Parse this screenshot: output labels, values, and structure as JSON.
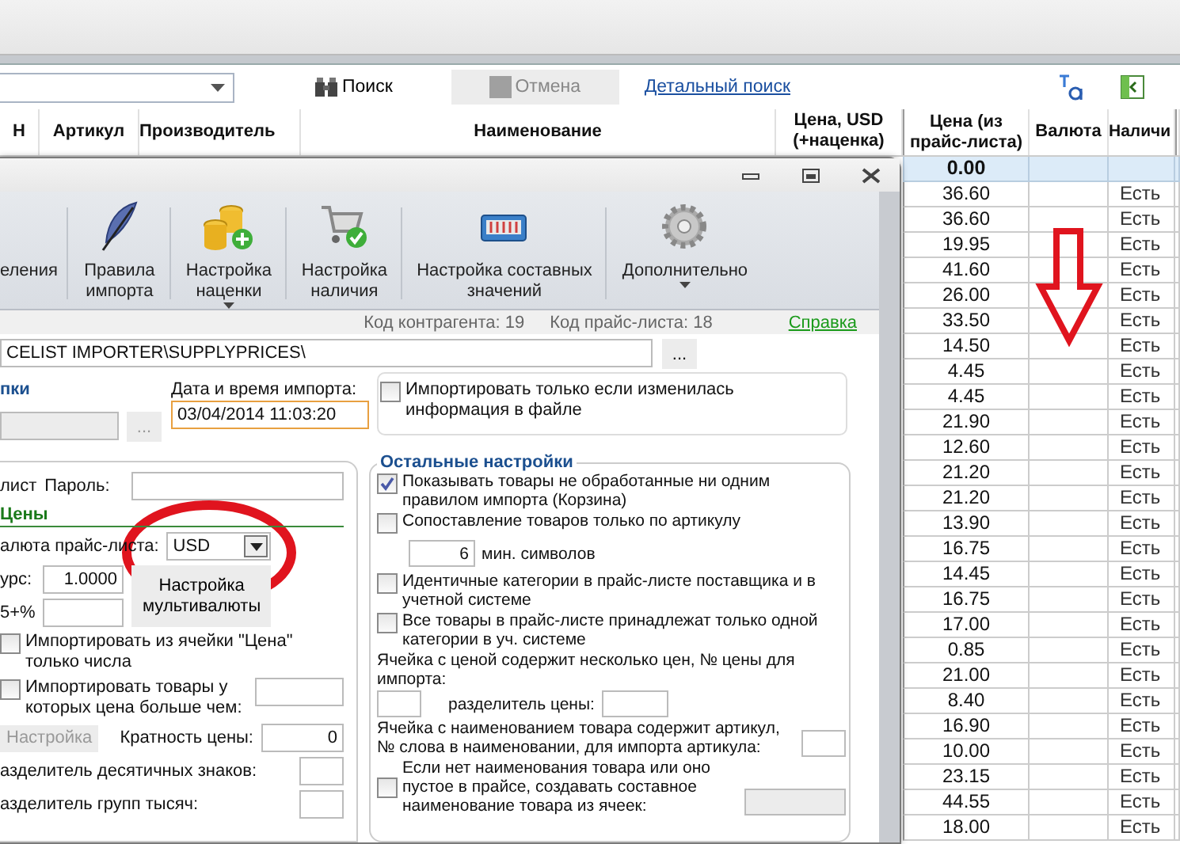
{
  "search_toolbar": {
    "search_button": "Поиск",
    "cancel_button": "Отмена",
    "detail_search_link": "Детальный поиск"
  },
  "table": {
    "columns": [
      "Н",
      "Артикул",
      "Производитель",
      "Наименование",
      "Цена, USD (+наценка)",
      "Цена (из прайс-листа)",
      "Валюта",
      "Наличи"
    ],
    "rows": [
      {
        "price": "0.00",
        "selected": true
      },
      {
        "price": "36.60",
        "availability": "Есть",
        "selected": false
      },
      {
        "price": "36.60",
        "availability": "Есть",
        "selected": false
      },
      {
        "price": "19.95",
        "availability": "Есть",
        "selected": false
      },
      {
        "price": "41.60",
        "availability": "Есть",
        "selected": false
      },
      {
        "price": "26.00",
        "availability": "Есть",
        "selected": false
      },
      {
        "price": "33.50",
        "availability": "Есть",
        "selected": false
      },
      {
        "price": "14.50",
        "availability": "Есть",
        "selected": false
      },
      {
        "price": "4.45",
        "availability": "Есть",
        "selected": false
      },
      {
        "price": "4.45",
        "availability": "Есть",
        "selected": false
      },
      {
        "price": "21.90",
        "availability": "Есть",
        "selected": false
      },
      {
        "price": "12.60",
        "availability": "Есть",
        "selected": false
      },
      {
        "price": "21.20",
        "availability": "Есть",
        "selected": false
      },
      {
        "price": "21.20",
        "availability": "Есть",
        "selected": false
      },
      {
        "price": "13.90",
        "availability": "Есть",
        "selected": false
      },
      {
        "price": "16.75",
        "availability": "Есть",
        "selected": false
      },
      {
        "price": "14.45",
        "availability": "Есть",
        "selected": false
      },
      {
        "price": "16.75",
        "availability": "Есть",
        "selected": false
      },
      {
        "price": "17.00",
        "availability": "Есть",
        "selected": false
      },
      {
        "price": "0.85",
        "availability": "Есть",
        "selected": false
      },
      {
        "price": "21.00",
        "availability": "Есть",
        "selected": false
      },
      {
        "price": "8.40",
        "availability": "Есть",
        "selected": false
      },
      {
        "price": "16.90",
        "availability": "Есть",
        "selected": false
      },
      {
        "price": "10.00",
        "availability": "Есть",
        "selected": false
      },
      {
        "price": "23.15",
        "availability": "Есть",
        "selected": false
      },
      {
        "price": "44.55",
        "availability": "Есть",
        "selected": false
      },
      {
        "price": "18.00",
        "availability": "Есть",
        "selected": false
      }
    ]
  },
  "dialog": {
    "ribbon": [
      {
        "label": "еления",
        "has_menu": false
      },
      {
        "label": "Правила импорта",
        "has_menu": false
      },
      {
        "label": "Настройка наценки",
        "has_menu": true
      },
      {
        "label": "Настройка наличия",
        "has_menu": false
      },
      {
        "label": "Настройка составных значений",
        "has_menu": false
      },
      {
        "label": "Дополнительно",
        "has_menu": true
      }
    ],
    "info": {
      "counterparty_code": "Код контрагента: 19",
      "pricelist_code": "Код прайс-листа: 18",
      "help_link": "Справка"
    },
    "path_field": {
      "value": "CELIST IMPORTER\\SUPPLYPRICES\\",
      "browse_button": "..."
    },
    "source": {
      "section_title": "пки",
      "browse_button": "...",
      "import_date_label": "Дата и время импорта:",
      "import_date": "03/04/2014 11:03:20",
      "only_if_changed": {
        "label": "Импортировать только если изменилась информация в файле",
        "checked": false
      }
    },
    "left_group": {
      "login_label": "лист",
      "password_label": "Пароль:",
      "prices_title": "Цены",
      "currency_label": "алюта прайс-листа:",
      "currency": "USD",
      "rate_label": "урс:",
      "rate": "1.0000",
      "multicurrency_button": "Настройка мультивалюты",
      "markup_label": "5+%",
      "numbers_only": {
        "label": "Импортировать из ячейки \"Цена\" только числа",
        "checked": false
      },
      "min_price": {
        "label": "Импортировать товары у которых цена больше чем:",
        "checked": false
      },
      "setup_button": {
        "label": "Настройка",
        "disabled": true
      },
      "multiplicity_label": "Кратность цены:",
      "multiplicity": "0",
      "decimal_separator_label": "азделитель десятичных знаков:",
      "thousands_separator_label": "азделитель групп тысяч:"
    },
    "right_group": {
      "title": "Остальные настройки",
      "items": [
        {
          "kind": "checkbox",
          "label": "Показывать товары не обработанные ни одним правилом импорта (Корзина)",
          "checked": true
        },
        {
          "kind": "checkbox",
          "label": "Сопоставление товаров только по артикулу",
          "checked": false
        },
        {
          "kind": "number",
          "value": "6",
          "label": "мин. символов"
        },
        {
          "kind": "checkbox",
          "label": "Идентичные категории в прайс-листе поставщика и в учетной системе",
          "checked": false
        },
        {
          "kind": "checkbox",
          "label": "Все товары в прайс-листе принадлежат только одной категории в уч. системе",
          "checked": false
        },
        {
          "kind": "fields",
          "label": "Ячейка с ценой содержит несколько цен, № цены для импорта:",
          "label_2": "разделитель цены:"
        },
        {
          "kind": "field",
          "label": "Ячейка с наименованием товара содержит артикул, № слова в наименовании, для импорта артикула:"
        },
        {
          "kind": "checkbox_field",
          "label": "Если нет наименования товара или оно пустое в прайсе, создавать составное наименование товара из ячеек:",
          "checked": false
        }
      ]
    }
  }
}
